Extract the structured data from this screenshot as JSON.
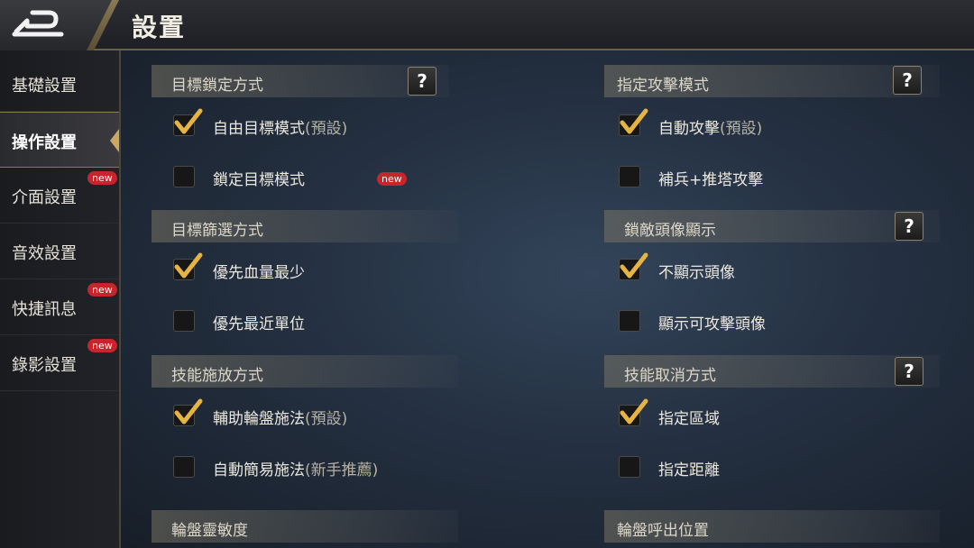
{
  "header": {
    "title": "設置",
    "back_icon": "back-arrow-icon"
  },
  "sidebar": {
    "items": [
      {
        "label": "基礎設置",
        "active": false,
        "badge": ""
      },
      {
        "label": "操作設置",
        "active": true,
        "badge": ""
      },
      {
        "label": "介面設置",
        "active": false,
        "badge": "new"
      },
      {
        "label": "音效設置",
        "active": false,
        "badge": ""
      },
      {
        "label": "快捷訊息",
        "active": false,
        "badge": "new"
      },
      {
        "label": "錄影設置",
        "active": false,
        "badge": "new"
      }
    ]
  },
  "sections": {
    "target_lock": {
      "title": "目標鎖定方式",
      "help": "?",
      "options": [
        {
          "label": "自由目標模式",
          "sub": "(預設)",
          "checked": true
        },
        {
          "label": "鎖定目標模式",
          "sub": "",
          "checked": false,
          "badge": "new"
        }
      ]
    },
    "attack_mode": {
      "title": "指定攻擊模式",
      "help": "?",
      "options": [
        {
          "label": "自動攻擊",
          "sub": "(預設)",
          "checked": true
        },
        {
          "label": "補兵+推塔攻擊",
          "sub": "",
          "checked": false
        }
      ]
    },
    "target_filter": {
      "title": "目標篩選方式",
      "options": [
        {
          "label": "優先血量最少",
          "sub": "",
          "checked": true
        },
        {
          "label": "優先最近單位",
          "sub": "",
          "checked": false
        }
      ]
    },
    "enemy_avatar": {
      "title": "鎖敵頭像顯示",
      "help": "?",
      "options": [
        {
          "label": "不顯示頭像",
          "sub": "",
          "checked": true
        },
        {
          "label": "顯示可攻擊頭像",
          "sub": "",
          "checked": false
        }
      ]
    },
    "skill_cast": {
      "title": "技能施放方式",
      "options": [
        {
          "label": "輔助輪盤施法",
          "sub": "(預設)",
          "checked": true
        },
        {
          "label": "自動簡易施法",
          "sub": "(新手推薦)",
          "checked": false
        }
      ]
    },
    "skill_cancel": {
      "title": "技能取消方式",
      "help": "?",
      "options": [
        {
          "label": "指定區域",
          "sub": "",
          "checked": true
        },
        {
          "label": "指定距離",
          "sub": "",
          "checked": false
        }
      ]
    },
    "wheel_sensitivity": {
      "title": "輪盤靈敏度"
    },
    "wheel_position": {
      "title": "輪盤呼出位置"
    }
  },
  "colors": {
    "accent_gold": "#c9a866",
    "badge_red": "#c8242c",
    "check_gold": "#e6b443"
  }
}
